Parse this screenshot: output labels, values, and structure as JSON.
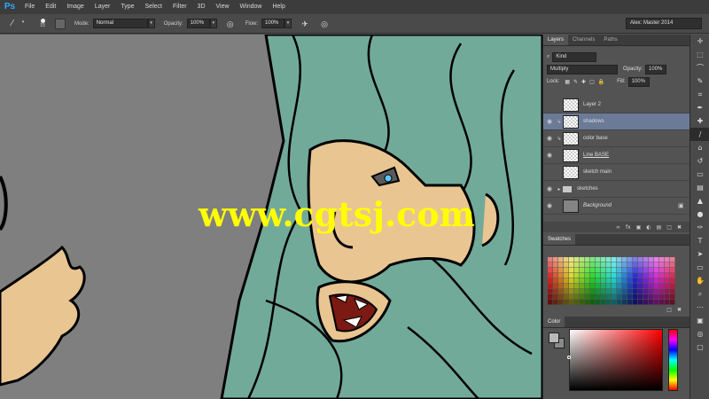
{
  "app": {
    "logo": "Ps"
  },
  "menu": [
    "File",
    "Edit",
    "Image",
    "Layer",
    "Type",
    "Select",
    "Filter",
    "3D",
    "View",
    "Window",
    "Help"
  ],
  "options": {
    "brush_size": "15",
    "mode_label": "Mode:",
    "mode_value": "Normal",
    "opacity_label": "Opacity:",
    "opacity_value": "100%",
    "flow_label": "Flow:",
    "flow_value": "100%",
    "workspace": "Alex: Master 2014"
  },
  "layers_panel": {
    "tabs": [
      "Layers",
      "Channels",
      "Paths"
    ],
    "filter_value": "Kind",
    "blend_mode": "Multiply",
    "opacity_label": "Opacity:",
    "opacity_value": "100%",
    "lock_label": "Lock:",
    "fill_label": "Fill:",
    "fill_value": "100%",
    "layers": [
      {
        "name": "Layer 2",
        "visible": false,
        "selected": false,
        "clipped": false
      },
      {
        "name": "shadows",
        "visible": true,
        "selected": true,
        "clipped": true
      },
      {
        "name": "color base",
        "visible": true,
        "selected": false,
        "clipped": true
      },
      {
        "name": "Line BASE",
        "visible": true,
        "selected": false,
        "clipped": false
      },
      {
        "name": "sketch main",
        "visible": false,
        "selected": false,
        "clipped": false
      },
      {
        "name": "sketches",
        "visible": true,
        "selected": false,
        "clipped": false,
        "group": true
      },
      {
        "name": "Background",
        "visible": true,
        "selected": false,
        "clipped": false,
        "locked": true
      }
    ]
  },
  "swatches_panel": {
    "title": "Swatches"
  },
  "color_panel": {
    "title": "Color",
    "fg": "#b9b9b9",
    "bg": "#8a8a8a"
  },
  "watermark": "www.cgtsj.com"
}
